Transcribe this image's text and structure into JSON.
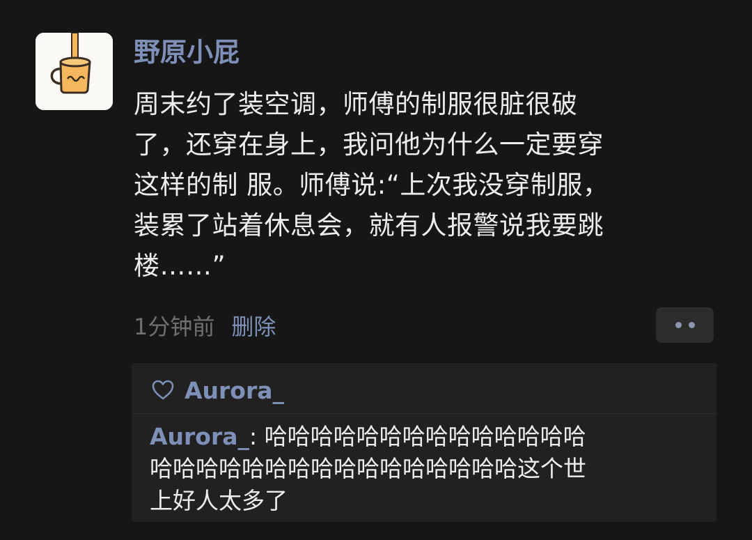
{
  "post": {
    "username": "野原小屁",
    "text_lines": [
      "周末约了装空调，师傅的制服很脏很破",
      "了，还穿在身上，我问他为什么一定要穿",
      "这样的制 服。师傅说:“上次我没穿制服，",
      "装累了站着休息会，就有人报警说我要跳",
      "楼……”"
    ],
    "time": "1分钟前",
    "delete_label": "删除",
    "more_icon": "more-dots-icon"
  },
  "comments": {
    "like_icon": "heart-icon",
    "liked_by": "Aurora_",
    "items": [
      {
        "author": "Aurora_",
        "separator": ": ",
        "lines": [
          "哈哈哈哈哈哈哈哈哈哈哈哈哈哈",
          "哈哈哈哈哈哈哈哈哈哈哈哈哈哈哈哈这个世",
          "上好人太多了"
        ]
      }
    ]
  },
  "colors": {
    "background": "#161616",
    "name_blue": "#7f90b8",
    "text": "#ecedef",
    "muted": "#6f7072",
    "panel": "#212121"
  }
}
